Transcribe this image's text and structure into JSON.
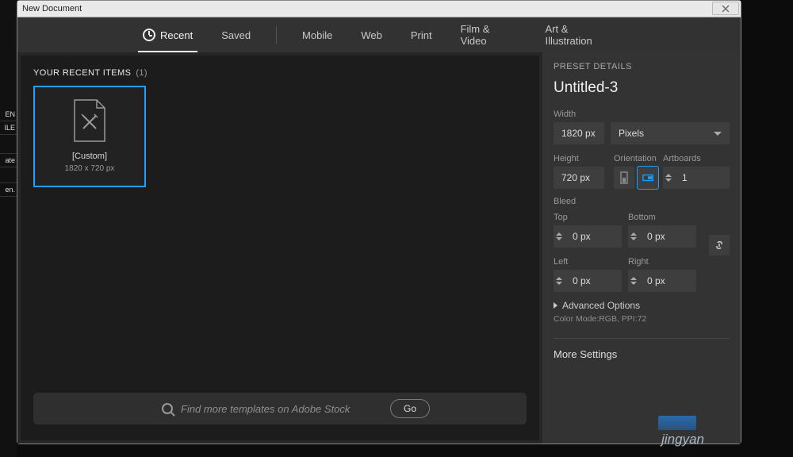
{
  "window_title": "New Document",
  "tabs": {
    "recent": "Recent",
    "saved": "Saved",
    "mobile": "Mobile",
    "web": "Web",
    "print": "Print",
    "film": "Film & Video",
    "art": "Art & Illustration"
  },
  "recent_section": {
    "heading": "YOUR RECENT ITEMS",
    "count": "(1)",
    "thumb_label": "[Custom]",
    "thumb_dim": "1820 x 720 px"
  },
  "search": {
    "placeholder": "Find more templates on Adobe Stock",
    "go": "Go"
  },
  "preset": {
    "heading": "PRESET DETAILS",
    "name": "Untitled-3",
    "width_label": "Width",
    "width_value": "1820 px",
    "units": "Pixels",
    "height_label": "Height",
    "height_value": "720 px",
    "orientation_label": "Orientation",
    "artboards_label": "Artboards",
    "artboards_value": "1",
    "bleed_label": "Bleed",
    "top_label": "Top",
    "bottom_label": "Bottom",
    "left_label": "Left",
    "right_label": "Right",
    "bleed_top": "0 px",
    "bleed_bottom": "0 px",
    "bleed_left": "0 px",
    "bleed_right": "0 px",
    "advanced": "Advanced Options",
    "meta": "Color Mode:RGB, PPI:72",
    "more": "More Settings"
  },
  "watermark": "jingyan"
}
